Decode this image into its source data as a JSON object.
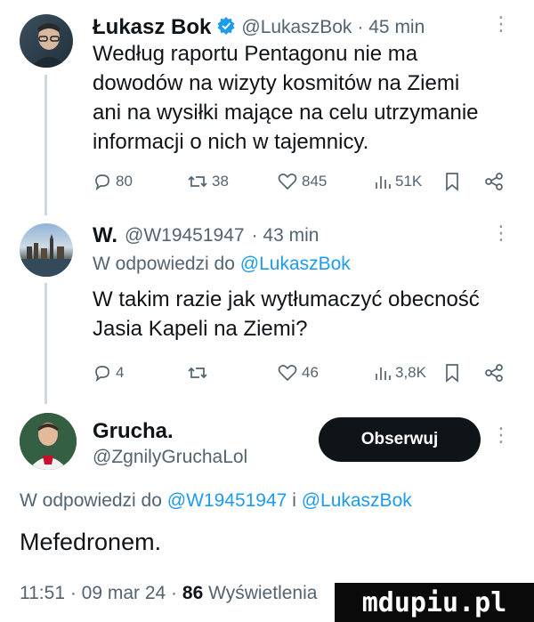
{
  "tweet1": {
    "author_name": "Łukasz Bok",
    "handle": "@LukaszBok",
    "time": "· 45 min",
    "lines": [
      "Według raportu Pentagonu nie ma",
      "dowodów na wizyty kosmitów na Ziemi",
      "ani na wysiłki mające na celu utrzymanie",
      "informacji o nich w tajemnicy."
    ],
    "actions": {
      "replies": "80",
      "retweets": "38",
      "likes": "845",
      "views": "51K"
    }
  },
  "tweet2": {
    "author_name": "W.",
    "handle": "@W19451947",
    "time": "· 43 min",
    "reply_prefix": "W odpowiedzi do",
    "reply_to": "@LukaszBok",
    "lines": [
      "W takim razie jak wytłumaczyć obecność",
      "Jasia Kapeli na Ziemi?"
    ],
    "actions": {
      "replies": "4",
      "retweets": "",
      "likes": "46",
      "views": "3,8K"
    }
  },
  "main_tweet": {
    "author_name": "Grucha.",
    "handle": "@ZgnilyGruchaLol",
    "follow_label": "Obserwuj",
    "reply_prefix": "W odpowiedzi do",
    "reply_to_1": "@W19451947",
    "reply_joiner": "i",
    "reply_to_2": "@LukaszBok",
    "text": "Mefedronem.",
    "timestamp": "11:51 · 09 mar 24 ·",
    "views_count": "86",
    "views_label": "Wyświetlenia"
  },
  "watermark": "mdupiu.pl",
  "colors": {
    "accent": "#1d9bf0",
    "muted": "#536471",
    "verified": "#1d9bf0"
  }
}
